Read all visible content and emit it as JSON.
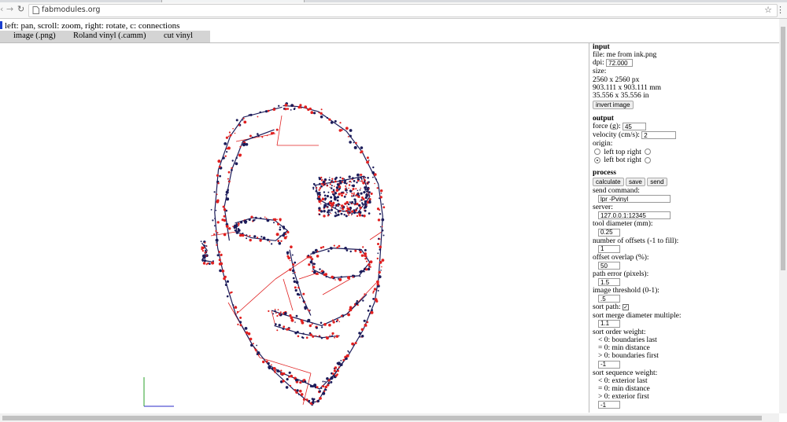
{
  "browser": {
    "url": "fabmodules.org",
    "back_icon": "back-arrow-icon",
    "forward_icon": "forward-arrow-icon",
    "reload_icon": "reload-icon",
    "page_icon": "page-icon",
    "bookmark_icon": "star-icon",
    "menu_icon": "menu-dots-icon"
  },
  "hint": "left: pan, scroll: zoom, right: rotate, c: connections",
  "tabs": [
    "image (.png)",
    "Roland vinyl (.camm)",
    "cut vinyl"
  ],
  "input": {
    "title": "input",
    "file": "file: me from ink.png",
    "dpi_label": "dpi:",
    "dpi_value": "72.000",
    "size_label": "size:",
    "size_px": "2560 x 2560 px",
    "size_mm": "903.111 x 903.111 mm",
    "size_in": "35.556 x 35.556 in",
    "invert_button": "invert image"
  },
  "output": {
    "title": "output",
    "force_label": "force (g):",
    "force_value": "45",
    "velocity_label": "velocity (cm/s):",
    "velocity_value": "2",
    "origin_label": "origin:",
    "origin_top": "left top right",
    "origin_bot": "left bot right",
    "origin_selected": "left bot"
  },
  "process": {
    "title": "process",
    "calculate_button": "calculate",
    "save_button": "save",
    "send_button": "send",
    "send_command_label": "send command:",
    "send_command_value": "lpr -Pvinyl",
    "server_label": "server:",
    "server_value": "127.0.0.1:12345",
    "tool_diameter_label": "tool diameter (mm):",
    "tool_diameter_value": "0.25",
    "offsets_label": "number of offsets (-1 to fill):",
    "offsets_value": "1",
    "overlap_label": "offset overlap (%):",
    "overlap_value": "50",
    "path_error_label": "path error (pixels):",
    "path_error_value": "1.5",
    "threshold_label": "image threshold (0-1):",
    "threshold_value": ".5",
    "sort_path_label": "sort path:",
    "sort_path_checked": true,
    "sort_merge_label": "sort merge diameter multiple:",
    "sort_merge_value": "1.1",
    "sort_order_label": "sort order weight:",
    "sort_order_lines": [
      "< 0: boundaries last",
      "= 0: min distance",
      "> 0: boundaries first"
    ],
    "sort_order_value": "-1",
    "sort_seq_label": "sort sequence weight:",
    "sort_seq_lines": [
      "< 0: exterior last",
      "= 0: min distance",
      "> 0: exterior first"
    ],
    "sort_seq_value": "-1"
  },
  "colors": {
    "toolpath": "#1c1c5a",
    "jumps": "#e02020",
    "axis_x": "#2a2ac8",
    "axis_y": "#2aa02a"
  }
}
